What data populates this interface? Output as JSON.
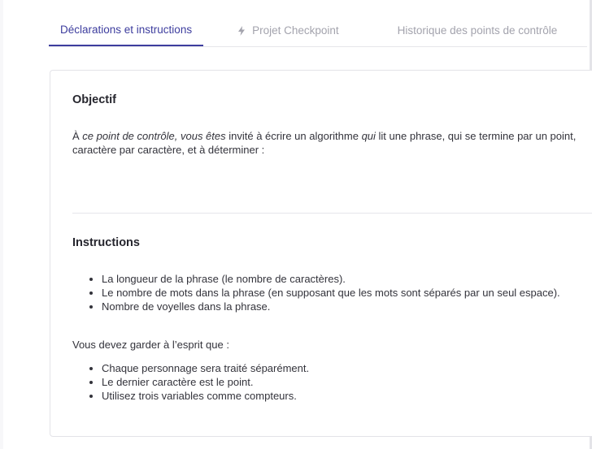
{
  "tabs": [
    {
      "label": "Déclarations et instructions",
      "active": true
    },
    {
      "label": "Projet Checkpoint",
      "active": false,
      "icon": "lightning-icon"
    },
    {
      "label": "Historique des points de contrôle",
      "active": false
    }
  ],
  "objectif": {
    "title": "Objectif",
    "text_a": "À ",
    "text_b": "ce point de contrôle, vous êtes",
    "text_c": " invité à écrire un algorithme ",
    "text_d": "qui",
    "text_e": " lit une phrase, qui se termine par un point, caractère par caractère, et à déterminer :"
  },
  "instructions": {
    "title": "Instructions",
    "list1": [
      "La longueur de la phrase (le nombre de caractères).",
      "Le nombre de mots dans la phrase (en supposant que les mots sont séparés par un seul espace).",
      "Nombre de voyelles dans la phrase."
    ],
    "note": "Vous devez garder à l’esprit que :",
    "list2": [
      "Chaque personnage sera traité séparément.",
      "Le dernier caractère est le point.",
      "Utilisez trois variables comme compteurs."
    ]
  },
  "colors": {
    "accent": "#3d3d9e",
    "inactive_tab": "#a3a3ad"
  }
}
